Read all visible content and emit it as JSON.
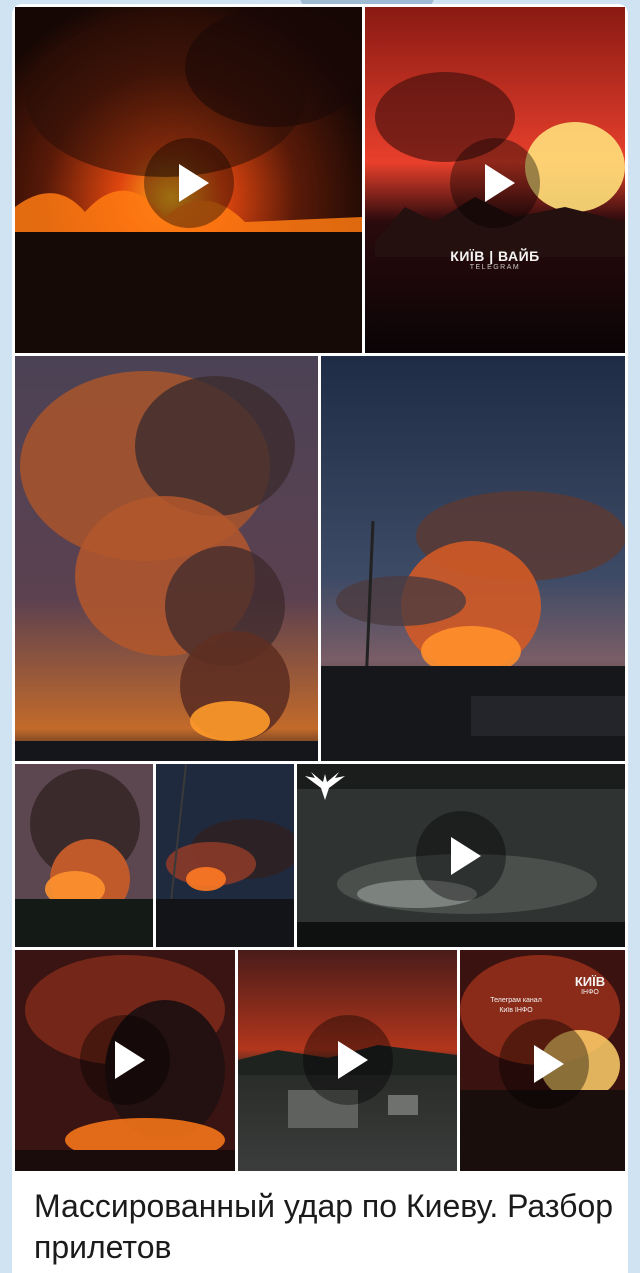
{
  "message": {
    "caption": "Массированный удар по Киеву. Разбор прилетов",
    "album": {
      "items": [
        {
          "type": "video"
        },
        {
          "type": "video",
          "watermark": "КИЇВ | ВАЙБ",
          "watermark_sub": "TELEGRAM"
        },
        {
          "type": "photo"
        },
        {
          "type": "photo"
        },
        {
          "type": "photo"
        },
        {
          "type": "photo"
        },
        {
          "type": "video",
          "logo": "eagle-logo"
        },
        {
          "type": "video"
        },
        {
          "type": "video"
        },
        {
          "type": "video",
          "channel_label": "Телеграм канал",
          "channel_name": "Київ ІНФО",
          "watermark": "КИЇВ",
          "watermark_sub": "ІНФО"
        }
      ]
    }
  },
  "icons": {
    "play": "play-icon",
    "eagle": "eagle-logo"
  },
  "colors": {
    "background": "#cfe3f3",
    "bubble": "#ffffff",
    "text": "#1b1b1b"
  }
}
